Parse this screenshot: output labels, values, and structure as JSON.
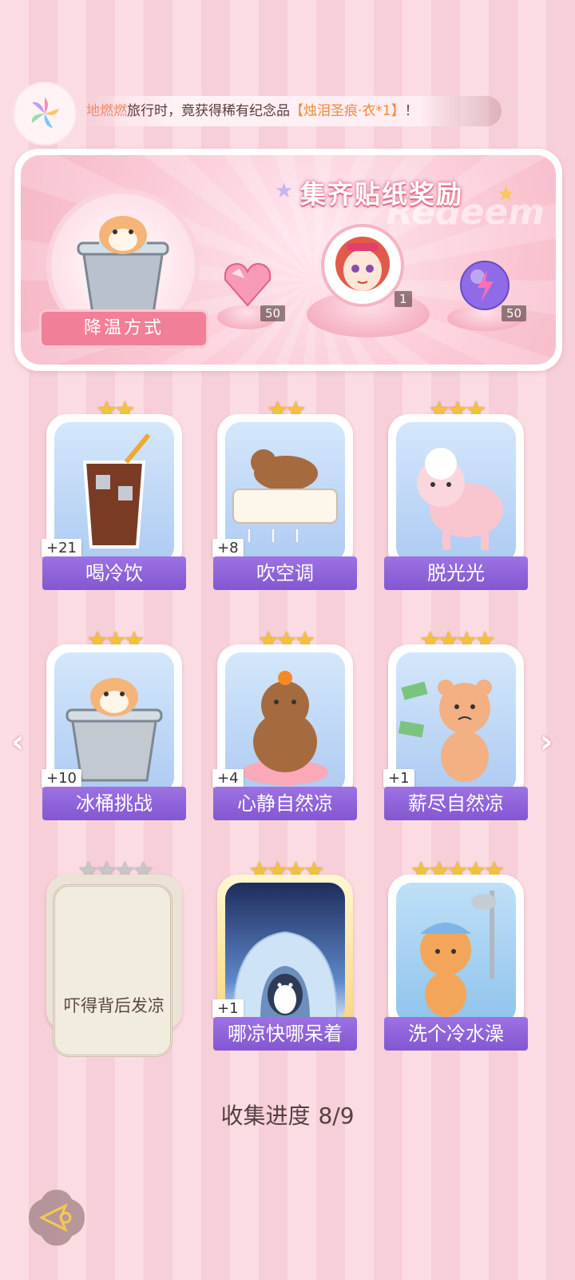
{
  "ticker": {
    "prefix": "地燃燃",
    "middle": "旅行时，竟获得稀有纪念品",
    "item": "【烛泪圣痕·衣*1】",
    "suffix": "！"
  },
  "banner": {
    "title": "集齐贴纸奖励",
    "watermark": "Redeem",
    "method_label": "降温方式",
    "rewards": [
      {
        "name": "heart-gem",
        "count": "50"
      },
      {
        "name": "character-avatar",
        "count": "1"
      },
      {
        "name": "energy-orb",
        "count": "50"
      }
    ]
  },
  "cards": [
    {
      "name": "喝冷饮",
      "plus": "+21",
      "stars": "★★"
    },
    {
      "name": "吹空调",
      "plus": "+8",
      "stars": "★★"
    },
    {
      "name": "脱光光",
      "plus": "",
      "stars": "★★★"
    },
    {
      "name": "冰桶挑战",
      "plus": "+10",
      "stars": "★★★"
    },
    {
      "name": "心静自然凉",
      "plus": "+4",
      "stars": "★★★"
    },
    {
      "name": "薪尽自然凉",
      "plus": "+1",
      "stars": "★★★★"
    },
    {
      "name": "吓得背后发凉",
      "plus": "",
      "stars": "★★★★",
      "locked": true
    },
    {
      "name": "哪凉快哪呆着",
      "plus": "+1",
      "stars": "★★★★"
    },
    {
      "name": "洗个冷水澡",
      "plus": "",
      "stars": "★★★★★"
    }
  ],
  "progress": {
    "label": "收集进度",
    "value": "8/9"
  },
  "colors": {
    "accent": "#8257d1",
    "pink": "#f27f98",
    "star": "#f3c23c"
  }
}
